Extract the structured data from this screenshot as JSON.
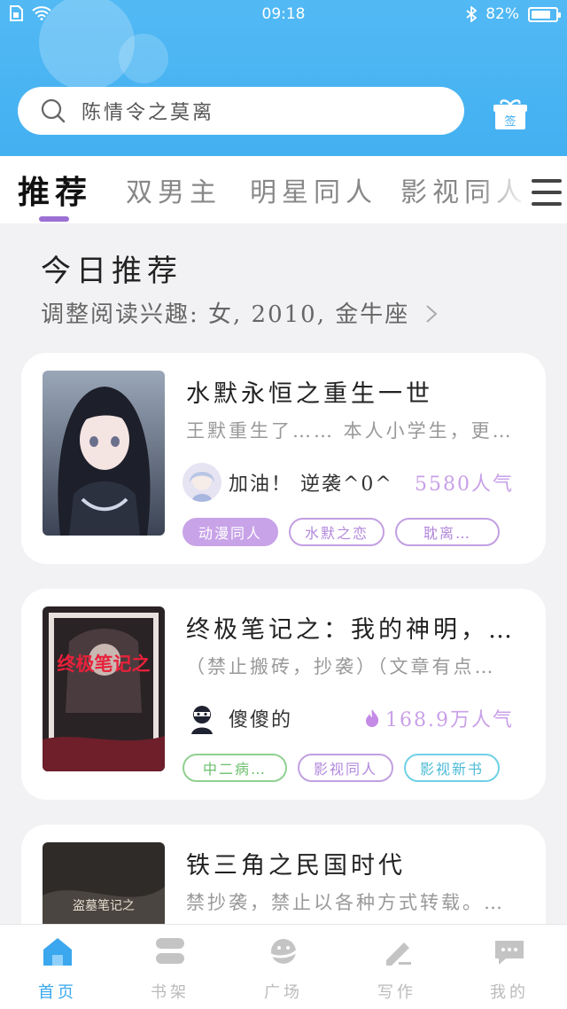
{
  "status_bar": {
    "time": "09:18",
    "battery": "82%",
    "battery_level": 0.82
  },
  "search": {
    "text": "陈情令之莫离"
  },
  "gift_badge": "签",
  "tabs": [
    {
      "label": "推荐",
      "active": true
    },
    {
      "label": "双男主",
      "active": false
    },
    {
      "label": "明星同人",
      "active": false
    },
    {
      "label": "影视同人",
      "active": false
    }
  ],
  "section": {
    "title": "今日推荐",
    "interest": "调整阅读兴趣: 女, 2010, 金牛座"
  },
  "books": [
    {
      "title": "水默永恒之重生一世",
      "desc": "王默重生了…… 本人小学生，更…",
      "author": "加油！ 逆袭^0^",
      "popularity": "5580人气",
      "tags": [
        "动漫同人",
        "水默之恋",
        "耽离…"
      ]
    },
    {
      "title": "终极笔记之：我的神明，…",
      "desc": "（禁止搬砖，抄袭）（文章有点…",
      "author": "傻傻的",
      "popularity": "168.9万人气",
      "tags": [
        "中二病…",
        "影视同人",
        "影视新书"
      ],
      "cover_text": "终极笔记之"
    },
    {
      "title": "铁三角之民国时代",
      "desc": "禁抄袭，禁止以各种方式转载。…",
      "cover_text": "盗墓笔记之"
    }
  ],
  "bottom_nav": [
    {
      "label": "首页",
      "active": true
    },
    {
      "label": "书架",
      "active": false
    },
    {
      "label": "广场",
      "active": false
    },
    {
      "label": "写作",
      "active": false
    },
    {
      "label": "我的",
      "active": false
    }
  ],
  "colors": {
    "header": "#43b0f1",
    "accent": "#9b6fd3",
    "nav_active": "#3aa7ee",
    "popularity": "#c9a0e8"
  }
}
